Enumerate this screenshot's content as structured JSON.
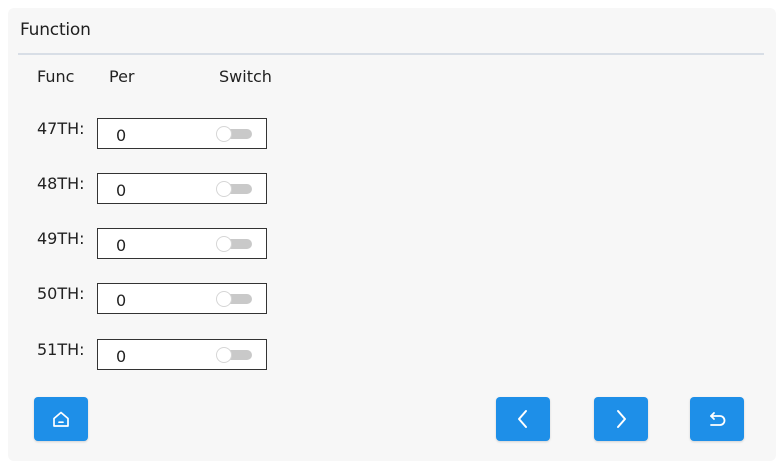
{
  "title": "Function",
  "headers": {
    "func": "Func",
    "per": "Per",
    "switch": "Switch"
  },
  "rows": [
    {
      "label": "47TH:",
      "value": "0",
      "switch_on": false
    },
    {
      "label": "48TH:",
      "value": "0",
      "switch_on": false
    },
    {
      "label": "49TH:",
      "value": "0",
      "switch_on": false
    },
    {
      "label": "50TH:",
      "value": "0",
      "switch_on": false
    },
    {
      "label": "51TH:",
      "value": "0",
      "switch_on": false
    }
  ],
  "buttons": {
    "home_icon": "home-icon",
    "prev_icon": "chevron-left-icon",
    "next_icon": "chevron-right-icon",
    "back_icon": "return-icon"
  },
  "colors": {
    "accent": "#1e8fe8",
    "panel": "#f7f7f7",
    "divider": "#d8dee6",
    "toggle_off": "#c9c9c9"
  }
}
